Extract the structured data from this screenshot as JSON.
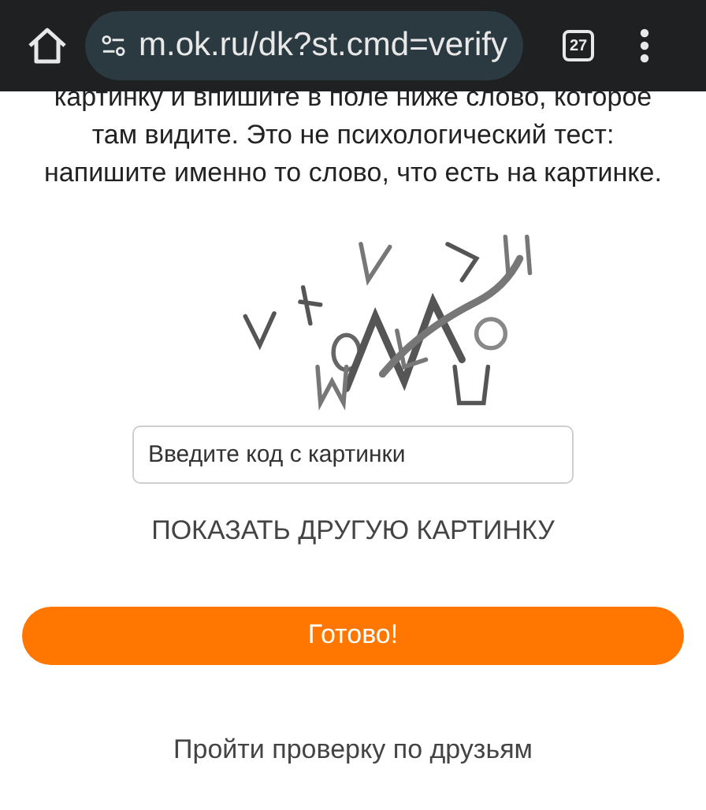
{
  "browser_bar": {
    "url": "m.ok.ru/dk?st.cmd=verify",
    "tab_count": "27"
  },
  "instructions": [
    "картинку и впишите в поле ниже слово, которое",
    "там видите. Это не психологический тест:",
    "напишите именно то слово, что есть на картинке."
  ],
  "code_field": {
    "placeholder": "Введите код с картинки"
  },
  "other_picture_link": "ПОКАЗАТЬ ДРУГУЮ КАРТИНКУ",
  "submit_button": "Готово!",
  "friends_check_link": "Пройти проверку по друзьям"
}
